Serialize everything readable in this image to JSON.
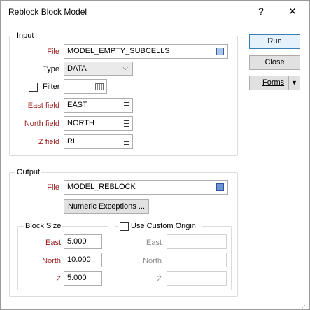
{
  "window": {
    "title": "Reblock Block Model",
    "help_label": "?",
    "close_label": "✕"
  },
  "input": {
    "group_label": "Input",
    "file_label": "File",
    "file_value": "MODEL_EMPTY_SUBCELLS",
    "type_label": "Type",
    "type_value": "DATA",
    "filter_label": "Filter",
    "filter_checked": false,
    "filter_value": "",
    "east_label": "East field",
    "east_value": "EAST",
    "north_label": "North field",
    "north_value": "NORTH",
    "z_label": "Z field",
    "z_value": "RL"
  },
  "output": {
    "group_label": "Output",
    "file_label": "File",
    "file_value": "MODEL_REBLOCK",
    "numeric_exceptions_label": "Numeric Exceptions ..."
  },
  "block_size": {
    "group_label": "Block Size",
    "east_label": "East",
    "east_value": "5.000",
    "north_label": "North",
    "north_value": "10.000",
    "z_label": "Z",
    "z_value": "5.000"
  },
  "custom_origin": {
    "checkbox_label": "Use Custom Origin",
    "checked": false,
    "east_label": "East",
    "east_value": "",
    "north_label": "North",
    "north_value": "",
    "z_label": "Z",
    "z_value": ""
  },
  "buttons": {
    "run_label": "Run",
    "close_label": "Close",
    "forms_label": "Forms",
    "forms_arrow": "▼"
  },
  "icons": {
    "list": "list-icon",
    "browse": "browse-icon",
    "calendar": "filter-edit-icon"
  },
  "colors": {
    "required_label": "#9b1b1b",
    "primary_button_border": "#3c7fb1",
    "disabled_text": "#8a8a8a"
  }
}
